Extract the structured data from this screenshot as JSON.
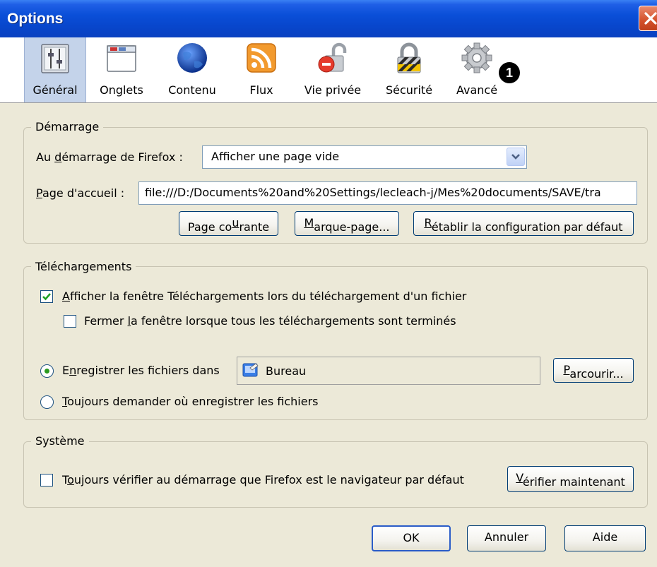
{
  "window": {
    "title": "Options"
  },
  "toolbar": {
    "items": [
      {
        "label": "Général",
        "icon": "general-icon"
      },
      {
        "label": "Onglets",
        "icon": "tabs-icon"
      },
      {
        "label": "Contenu",
        "icon": "content-globe-icon"
      },
      {
        "label": "Flux",
        "icon": "rss-feed-icon"
      },
      {
        "label": "Vie privée",
        "icon": "privacy-lock-icon"
      },
      {
        "label": "Sécurité",
        "icon": "security-padlock-icon"
      },
      {
        "label": "Avancé",
        "icon": "advanced-gear-icon"
      }
    ],
    "selected": "Général",
    "badge": "1"
  },
  "startup": {
    "group_title": "Démarrage",
    "startup_label_pre": "Au ",
    "startup_label_key": "d",
    "startup_label_post": "émarrage de Firefox :",
    "startup_value": "Afficher une page vide",
    "home_label_key": "P",
    "home_label_post": "age d'accueil :",
    "home_value": "file:///D:/Documents%20and%20Settings/lecleach-j/Mes%20documents/SAVE/tra",
    "btn_current_pre": "Page co",
    "btn_current_key": "u",
    "btn_current_post": "rante",
    "btn_bookmark_key": "M",
    "btn_bookmark_post": "arque-page...",
    "btn_restore_key": "R",
    "btn_restore_post": "établir la configuration par défaut"
  },
  "downloads": {
    "group_title": "Téléchargements",
    "show_window_key": "A",
    "show_window_post": "fficher la fenêtre Téléchargements lors du téléchargement d'un fichier",
    "show_window_checked": true,
    "close_window_pre": "Fermer ",
    "close_window_key": "l",
    "close_window_post": "a fenêtre lorsque tous les téléchargements sont terminés",
    "close_window_checked": false,
    "save_in_pre": "E",
    "save_in_key": "n",
    "save_in_post": "registrer les fichiers dans",
    "save_in_selected": true,
    "folder": "Bureau",
    "browse_key": "P",
    "browse_post": "arcourir...",
    "always_ask_key": "T",
    "always_ask_post": "oujours demander où enregistrer les fichiers",
    "always_ask_selected": false
  },
  "system": {
    "group_title": "Système",
    "check_default_pre": "T",
    "check_default_key": "o",
    "check_default_post": "ujours vérifier au démarrage que Firefox est le navigateur par défaut",
    "check_default_checked": false,
    "check_now_key": "V",
    "check_now_post": "érifier maintenant"
  },
  "footer": {
    "ok": "OK",
    "cancel": "Annuler",
    "help": "Aide"
  }
}
